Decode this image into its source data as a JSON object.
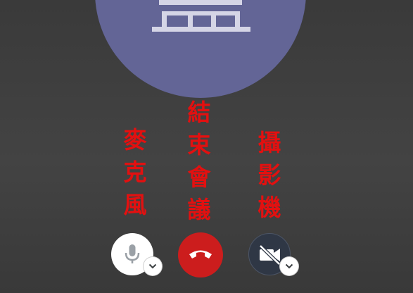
{
  "call": {
    "mic_label": "麥克風",
    "end_label": "結束會議",
    "camera_label": "攝影機"
  },
  "colors": {
    "background": "#404040",
    "avatar": "#636596",
    "label_text": "#e31010",
    "end_button": "#cc1d1d",
    "mic_button": "#ffffff",
    "camera_button": "#2f3745"
  },
  "icons": {
    "mic": "microphone-icon",
    "end": "phone-hangup-icon",
    "camera": "video-off-icon",
    "options": "chevron-down-icon"
  }
}
